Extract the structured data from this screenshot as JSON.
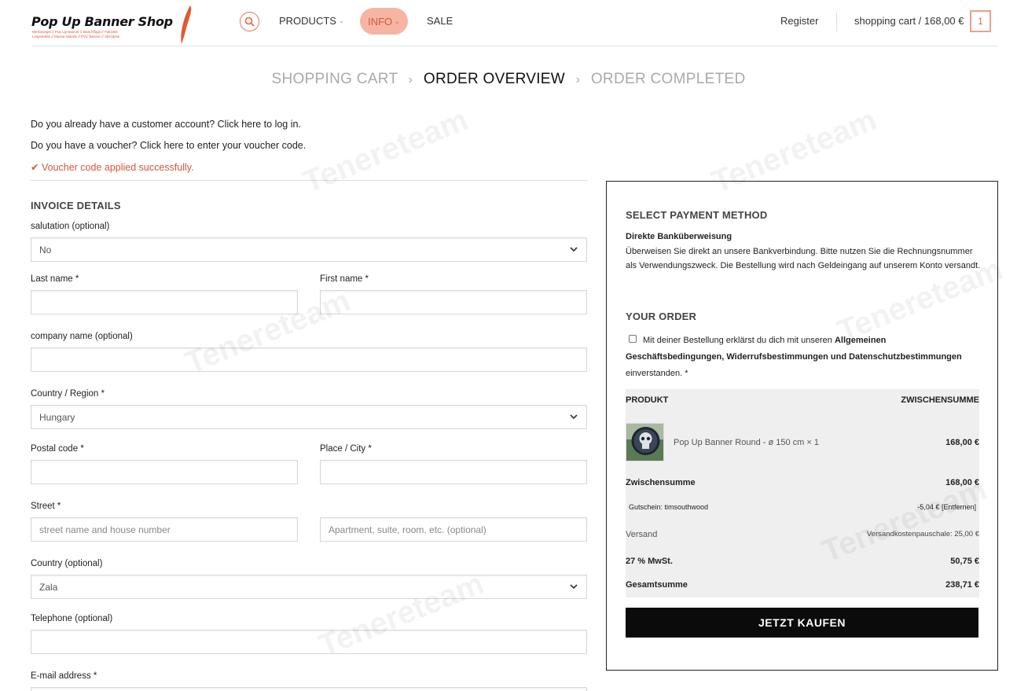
{
  "header": {
    "logo_title": "Pop Up Banner Shop",
    "logo_subline_1": "Werbesegel // Pop Up Banner // Beachflags // Faltzelte",
    "logo_subline_2": "Liegestühle // Messe-Stände // PVC Banner // Sitzsäcke",
    "nav": {
      "products": "PRODUCTS",
      "info": "INFO",
      "sale": "SALE"
    },
    "register": "Register",
    "cart": "shopping cart / 168,00 €",
    "cart_count": "1",
    "accent": "#e2683f"
  },
  "breadcrumb": {
    "step1": "SHOPPING CART",
    "step2": "ORDER OVERVIEW",
    "step3": "ORDER COMPLETED"
  },
  "notices": {
    "login": "Do you already have a customer account? Click here to log in.",
    "voucher": "Do you have a voucher? Click here to enter your voucher code.",
    "voucher_ok": "Voucher code applied successfully."
  },
  "invoice": {
    "title": "INVOICE DETAILS",
    "salutation_label": "salutation",
    "salutation_opt": "(optional)",
    "salutation_value": "No",
    "lastname_label": "Last name",
    "firstname_label": "First name",
    "company_label": "company name",
    "company_opt": "(optional)",
    "country_label": "Country / Region",
    "country_value": "Hungary",
    "postal_label": "Postal code",
    "city_label": "Place / City",
    "street_label": "Street",
    "street_placeholder": "street name and house number",
    "apartment_placeholder": "Apartment, suite, room, etc. (optional)",
    "county_label": "Country (optional)",
    "county_value": "Zala",
    "phone_label": "Telephone",
    "phone_opt": "(optional)",
    "email_label": "E-mail address",
    "required_mark": "*"
  },
  "payment": {
    "title": "SELECT PAYMENT METHOD",
    "method": "Direkte Banküberweisung",
    "description": "Überweisen Sie direkt an unsere Bankverbindung. Bitte nutzen Sie die Rechnungsnummer als Verwendungszweck. Die Bestellung wird nach Geldeingang auf unserem Konto versandt."
  },
  "order": {
    "title": "YOUR ORDER",
    "terms_prefix": "Mit deiner Bestellung erklärst du dich mit unseren",
    "terms_links": "Allgemeinen Geschäftsbedingungen, Widerrufsbestimmungen und Datenschutzbestimmungen",
    "terms_suffix": "einverstanden.",
    "required_mark": "*",
    "col_product": "PRODUKT",
    "col_subtotal": "ZWISCHENSUMME",
    "item_name": "Pop Up Banner Round - ø 150 cm",
    "item_qty": "× 1",
    "item_price": "168,00 €",
    "subtotal_label": "Zwischensumme",
    "subtotal_value": "168,00 €",
    "coupon_label": "Gutschein: timsouthwood",
    "coupon_value": "-5,04 €",
    "coupon_remove": "[Entfernen]",
    "shipping_label": "Versand",
    "shipping_value": "Versandkostenpauschale: 25,00 €",
    "vat_label": "27 % MwSt.",
    "vat_value": "50,75 €",
    "total_label": "Gesamtsumme",
    "total_value": "238,71 €",
    "buy_button": "JETZT KAUFEN"
  },
  "watermark": "Tenereteam"
}
